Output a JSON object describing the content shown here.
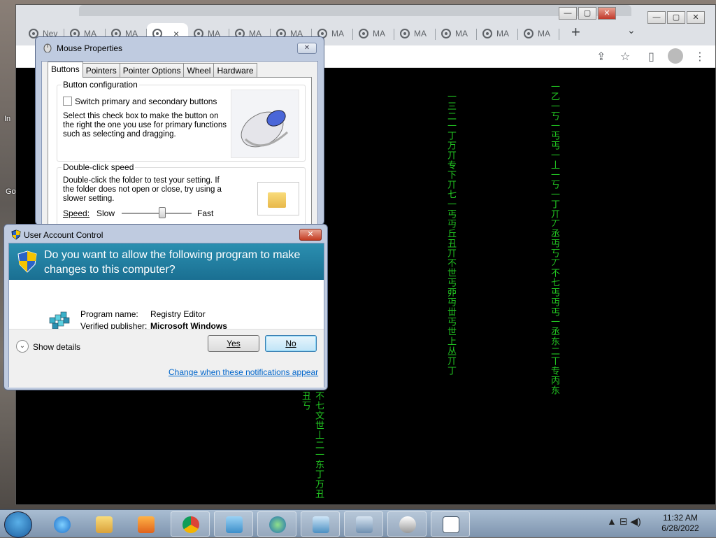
{
  "desktop": {
    "labels": [
      "In",
      "Go"
    ]
  },
  "chrome": {
    "tabs": [
      {
        "label": "Nev",
        "active": false
      },
      {
        "label": "MA",
        "active": false
      },
      {
        "label": "MA",
        "active": false
      },
      {
        "label": "",
        "active": true,
        "close": "×"
      },
      {
        "label": "MA",
        "active": false
      },
      {
        "label": "MA",
        "active": false
      },
      {
        "label": "MA",
        "active": false
      },
      {
        "label": "MA",
        "active": false
      },
      {
        "label": "MA",
        "active": false
      },
      {
        "label": "MA",
        "active": false
      },
      {
        "label": "MA",
        "active": false
      },
      {
        "label": "MA",
        "active": false
      },
      {
        "label": "MA",
        "active": false
      }
    ],
    "new_tab": "+",
    "tab_search": "⌄",
    "toolbar_icons": {
      "share": "⇪",
      "star": "☆",
      "sidebar": "▯",
      "menu": "⋮"
    },
    "window_buttons": {
      "min": "—",
      "max": "▢",
      "close": "✕"
    },
    "matrix": {
      "col1": "一三二一丁万丌专下丌七一丐丏丘丑丌不世丐丣丏丗丐世上丛丌丁",
      "col2": "一乙一丂一丐丐一丄一丂一丁丌丆丞丏丂丆不七丐丏丐一丞东二丅专丙东",
      "col3": "不七文世丄二一东丁万丑丑丂"
    }
  },
  "mouse_props": {
    "title": "Mouse Properties",
    "close": "✕",
    "tabs": [
      "Buttons",
      "Pointers",
      "Pointer Options",
      "Wheel",
      "Hardware"
    ],
    "button_config": {
      "group_label": "Button configuration",
      "checkbox_label": "Switch primary and secondary buttons",
      "description": "Select this check box to make the button on the right the one you use for primary functions such as selecting and dragging."
    },
    "double_click": {
      "group_label": "Double-click speed",
      "description": "Double-click the folder to test your setting. If the folder does not open or close, try using a slower setting.",
      "speed_label": "Speed:",
      "slow": "Slow",
      "fast": "Fast",
      "speed_level": 0.58
    }
  },
  "uac": {
    "title": "User Account Control",
    "close": "✕",
    "question": "Do you want to allow the following program to make changes to this computer?",
    "program_name_label": "Program name:",
    "program_name": "Registry Editor",
    "publisher_label": "Verified publisher:",
    "publisher": "Microsoft Windows",
    "show_details": "Show details",
    "details_chevron": "⌄",
    "yes": "Yes",
    "no": "No",
    "link": "Change when these notifications appear"
  },
  "taskbar": {
    "items": [
      "internet-explorer",
      "explorer",
      "media-player",
      "chrome",
      "control-panel",
      "network-globe",
      "network-settings",
      "computer",
      "mouse",
      "registry-window"
    ],
    "tray_icons": "▲ ⊟ ◀)",
    "time": "11:32 AM",
    "date": "6/28/2022"
  },
  "colors": {
    "uac_header": "#1a6f92",
    "matrix_green": "#22c722",
    "link": "#0066cc"
  }
}
